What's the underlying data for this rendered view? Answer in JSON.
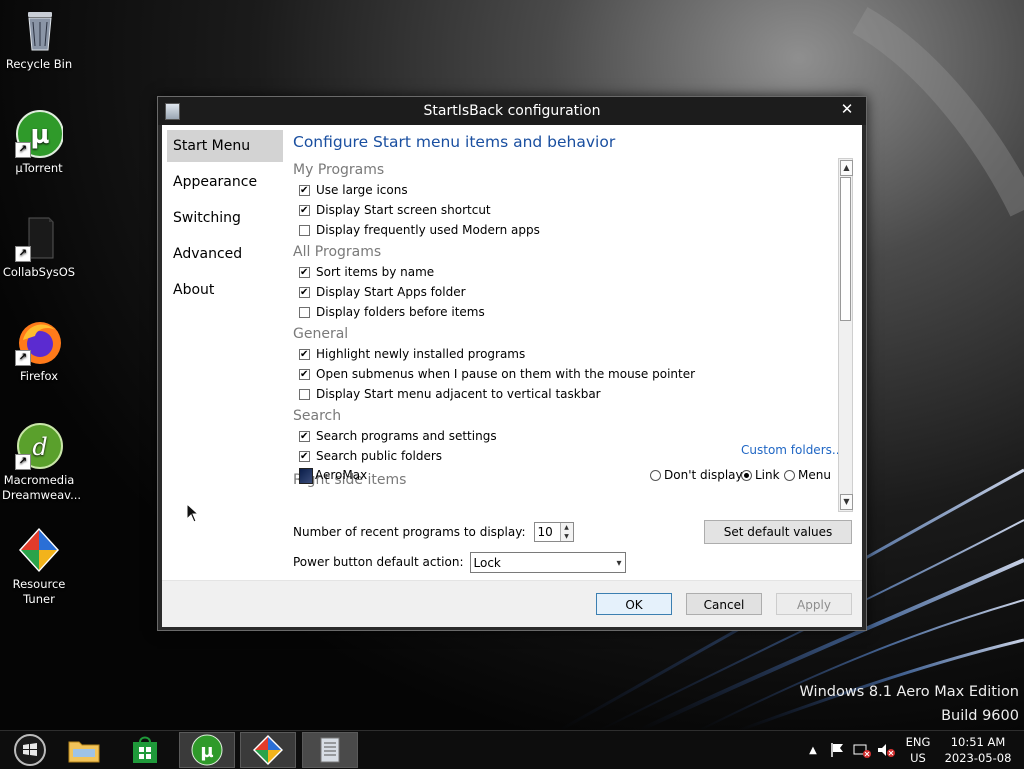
{
  "desktop": {
    "icons": [
      {
        "label": "Recycle Bin",
        "icon": "recycle-bin-icon"
      },
      {
        "label": "µTorrent",
        "icon": "utorrent-icon"
      },
      {
        "label": "CollabSysOS",
        "icon": "collabsysos-icon"
      },
      {
        "label": "Firefox",
        "icon": "firefox-icon"
      },
      {
        "label": "Macromedia Dreamweav...",
        "icon": "dreamweaver-icon"
      },
      {
        "label": "Resource Tuner",
        "icon": "resource-tuner-icon"
      }
    ],
    "watermark_line1": "Windows 8.1 Aero Max Edition",
    "watermark_line2": "Build 9600"
  },
  "dialog": {
    "title": "StartIsBack configuration",
    "close_symbol": "✕",
    "nav": [
      "Start Menu",
      "Appearance",
      "Switching",
      "Advanced",
      "About"
    ],
    "active_nav": "Start Menu",
    "heading": "Configure Start menu items and behavior",
    "groups": [
      {
        "title": "My Programs",
        "items": [
          {
            "label": "Use large icons",
            "checked": true
          },
          {
            "label": "Display Start screen shortcut",
            "checked": true
          },
          {
            "label": "Display frequently used Modern apps",
            "checked": false
          }
        ]
      },
      {
        "title": "All Programs",
        "items": [
          {
            "label": "Sort items by name",
            "checked": true
          },
          {
            "label": "Display Start Apps folder",
            "checked": true
          },
          {
            "label": "Display folders before items",
            "checked": false
          }
        ]
      },
      {
        "title": "General",
        "items": [
          {
            "label": "Highlight newly installed programs",
            "checked": true
          },
          {
            "label": "Open submenus when I pause on them with the mouse pointer",
            "checked": true
          },
          {
            "label": "Display Start menu adjacent to vertical taskbar",
            "checked": false
          }
        ]
      },
      {
        "title": "Search",
        "items": [
          {
            "label": "Search programs and settings",
            "checked": true
          },
          {
            "label": "Search public folders",
            "checked": true
          }
        ]
      },
      {
        "title": "Right side items",
        "items": []
      }
    ],
    "custom_folders_link": "Custom folders...",
    "right_side_item": {
      "label": "AeroMax",
      "options": [
        "Don't display",
        "Link",
        "Menu"
      ],
      "selected": "Link"
    },
    "recent_programs_label": "Number of recent programs to display:",
    "recent_programs_value": "10",
    "set_defaults_label": "Set default values",
    "power_button_label": "Power button default action:",
    "power_button_value": "Lock",
    "buttons": {
      "ok": "OK",
      "cancel": "Cancel",
      "apply": "Apply"
    }
  },
  "taskbar": {
    "items": [
      {
        "name": "start-button",
        "icon": "windows-logo-icon"
      },
      {
        "name": "file-explorer",
        "icon": "folder-icon"
      },
      {
        "name": "store",
        "icon": "store-icon"
      },
      {
        "name": "utorrent",
        "icon": "utorrent-icon",
        "active": true
      },
      {
        "name": "resource-tuner",
        "icon": "resource-tuner-icon",
        "active": true
      },
      {
        "name": "startisback-config",
        "icon": "config-window-icon",
        "active": true
      }
    ],
    "language_line1": "ENG",
    "language_line2": "US",
    "time": "10:51 AM",
    "date": "2023-05-08"
  }
}
